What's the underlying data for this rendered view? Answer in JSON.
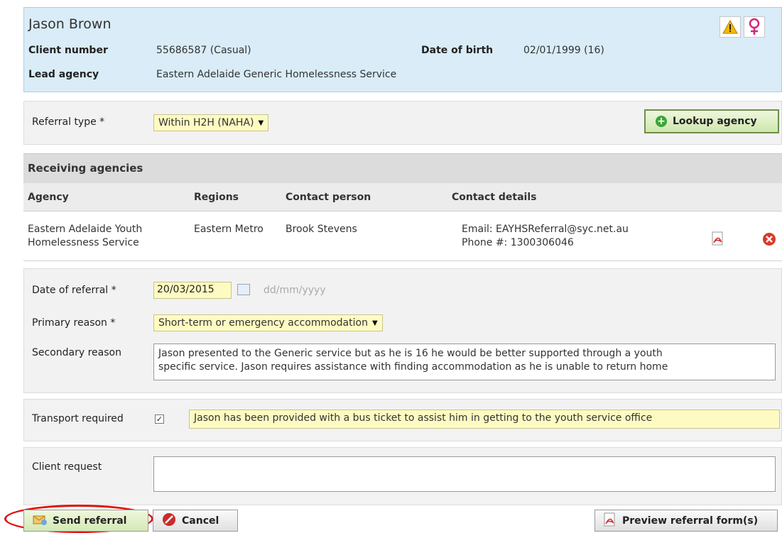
{
  "client": {
    "name": "Jason Brown",
    "client_number_label": "Client number",
    "client_number_value": "55686587 (Casual)",
    "dob_label": "Date of birth",
    "dob_value": "02/01/1999 (16)",
    "lead_agency_label": "Lead agency",
    "lead_agency_value": "Eastern Adelaide Generic Homelessness Service",
    "icons": [
      "warning-icon",
      "female-icon"
    ]
  },
  "referral_type": {
    "label": "Referral type *",
    "value": "Within H2H (NAHA)",
    "lookup_button": "Lookup agency"
  },
  "receiving_agencies": {
    "title": "Receiving agencies",
    "columns": [
      "Agency",
      "Regions",
      "Contact person",
      "Contact details"
    ],
    "rows": [
      {
        "agency_line1": "Eastern Adelaide Youth",
        "agency_line2": "Homelessness Service",
        "region": "Eastern Metro",
        "contact_person": "Brook Stevens",
        "email": "Email: EAYHSReferral@syc.net.au",
        "phone": "Phone #: 1300306046"
      }
    ]
  },
  "form": {
    "date_label": "Date of referral *",
    "date_value": "20/03/2015",
    "date_format_hint": "dd/mm/yyyy",
    "primary_reason_label": "Primary reason *",
    "primary_reason_value": "Short-term or emergency accommodation",
    "secondary_reason_label": "Secondary reason",
    "secondary_reason_line1": "Jason presented to the Generic service but as he is 16 he would be better supported through a youth",
    "secondary_reason_line2": "specific service. Jason requires assistance with finding accommodation as he is unable to return home",
    "transport_label": "Transport required",
    "transport_checked": true,
    "transport_note": "Jason has been provided with a bus ticket to assist him in getting to the youth service office",
    "client_request_label": "Client request",
    "client_request_value": ""
  },
  "actions": {
    "send": "Send referral",
    "cancel": "Cancel",
    "preview": "Preview referral form(s)"
  },
  "colors": {
    "header_bg": "#d9ecf7",
    "field_highlight": "#fdfbc2",
    "annotation_ring": "#e01010"
  }
}
